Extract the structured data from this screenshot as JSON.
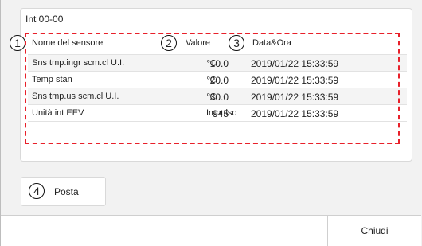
{
  "panel": {
    "title": "Int 00-00",
    "headers": {
      "name": "Nome del sensore",
      "value": "Valore",
      "datetime": "Data&Ora"
    },
    "rows": [
      {
        "name": "Sns tmp.ingr scm.cl U.I.",
        "value": "10.0",
        "unit": "℃",
        "datetime": "2019/01/22 15:33:59"
      },
      {
        "name": "Temp stan",
        "value": "20.0",
        "unit": "℃",
        "datetime": "2019/01/22 15:33:59"
      },
      {
        "name": "Sns tmp.us scm.cl U.I.",
        "value": "30.0",
        "unit": "℃",
        "datetime": "2019/01/22 15:33:59"
      },
      {
        "name": "Unità int EEV",
        "value": "945",
        "unit": "Impulso",
        "datetime": "2019/01/22 15:33:59"
      }
    ]
  },
  "callouts": [
    "1",
    "2",
    "3",
    "4"
  ],
  "post_button": {
    "label": "Posta"
  },
  "footer": {
    "close_label": "Chiudi"
  },
  "colors": {
    "annotation_red": "#e8202a"
  }
}
